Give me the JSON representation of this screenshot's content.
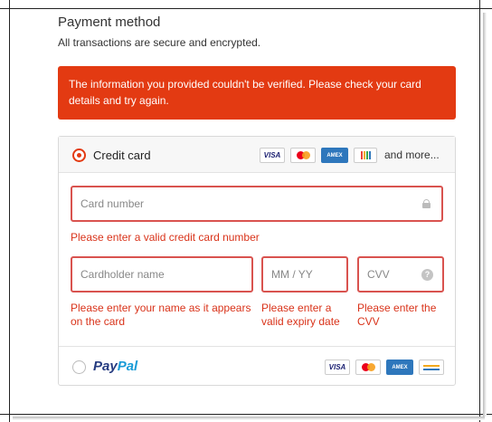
{
  "header": {
    "title": "Payment method",
    "subtitle": "All transactions are secure and encrypted."
  },
  "error_banner": {
    "message": "The information you provided couldn't be verified. Please check your card details and try again."
  },
  "credit_card": {
    "label": "Credit card",
    "selected": true,
    "brands": [
      "visa",
      "mastercard",
      "american-express",
      "discover"
    ],
    "visa_text": "VISA",
    "amex_text": "AMEX",
    "more_text": "and more...",
    "fields": {
      "card_number": {
        "placeholder": "Card number",
        "value": ""
      },
      "cardholder_name": {
        "placeholder": "Cardholder name",
        "value": ""
      },
      "expiry": {
        "placeholder": "MM / YY",
        "value": ""
      },
      "cvv": {
        "placeholder": "CVV",
        "value": ""
      }
    },
    "errors": {
      "card_number": "Please enter a valid credit card number",
      "cardholder_name": "Please enter your name as it appears on the card",
      "expiry": "Please enter a valid expiry date",
      "cvv": "Please enter the CVV"
    }
  },
  "paypal": {
    "label_part1": "Pay",
    "label_part2": "Pal",
    "selected": false,
    "brands": [
      "visa",
      "mastercard",
      "american-express",
      "generic-card"
    ],
    "visa_text": "VISA",
    "amex_text": "AMEX"
  },
  "colors": {
    "error": "#e33a12",
    "paypal_dark": "#253b80",
    "paypal_light": "#179bd7"
  }
}
